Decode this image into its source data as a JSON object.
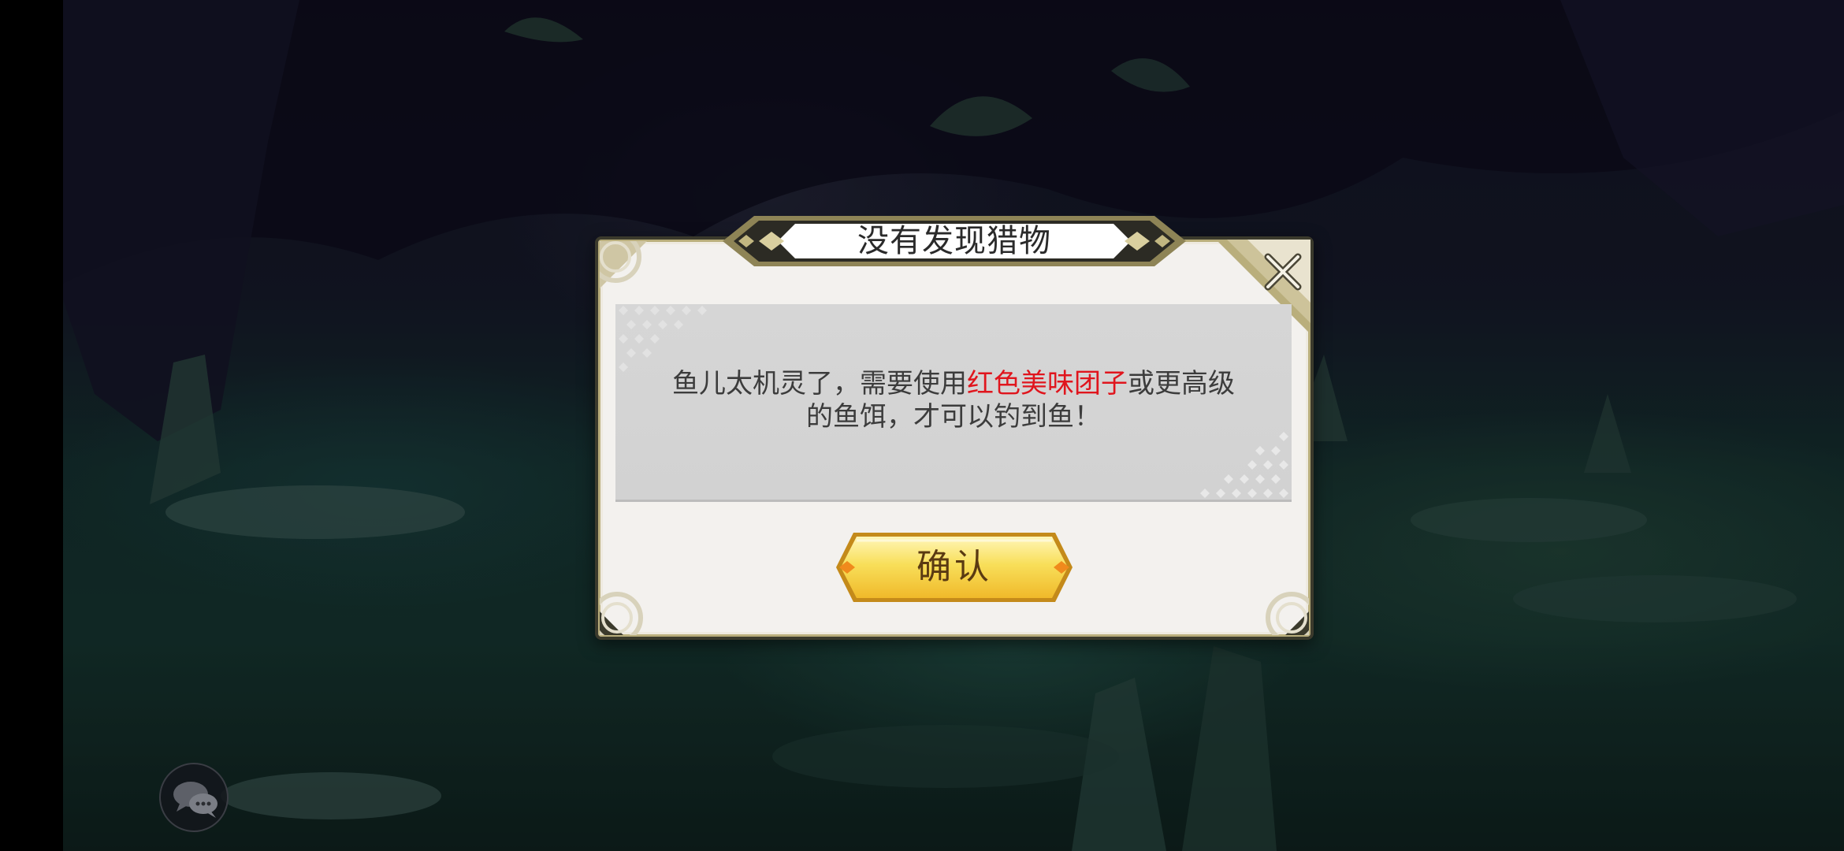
{
  "dialog": {
    "title": "没有发现猎物",
    "message_prefix": "鱼儿太机灵了，需要使用",
    "message_highlight": "红色美味团子",
    "message_suffix": "或更高级的鱼饵，才可以钓到鱼！",
    "confirm_label": "确认",
    "close_icon": "close-x-icon"
  },
  "hud": {
    "chat_icon": "chat-bubbles-icon"
  },
  "colors": {
    "highlight_text": "#e0151d",
    "confirm_gold": "#f4c93a",
    "frame_dark": "#3b3a2c",
    "panel_bg": "#f3f1ee"
  }
}
